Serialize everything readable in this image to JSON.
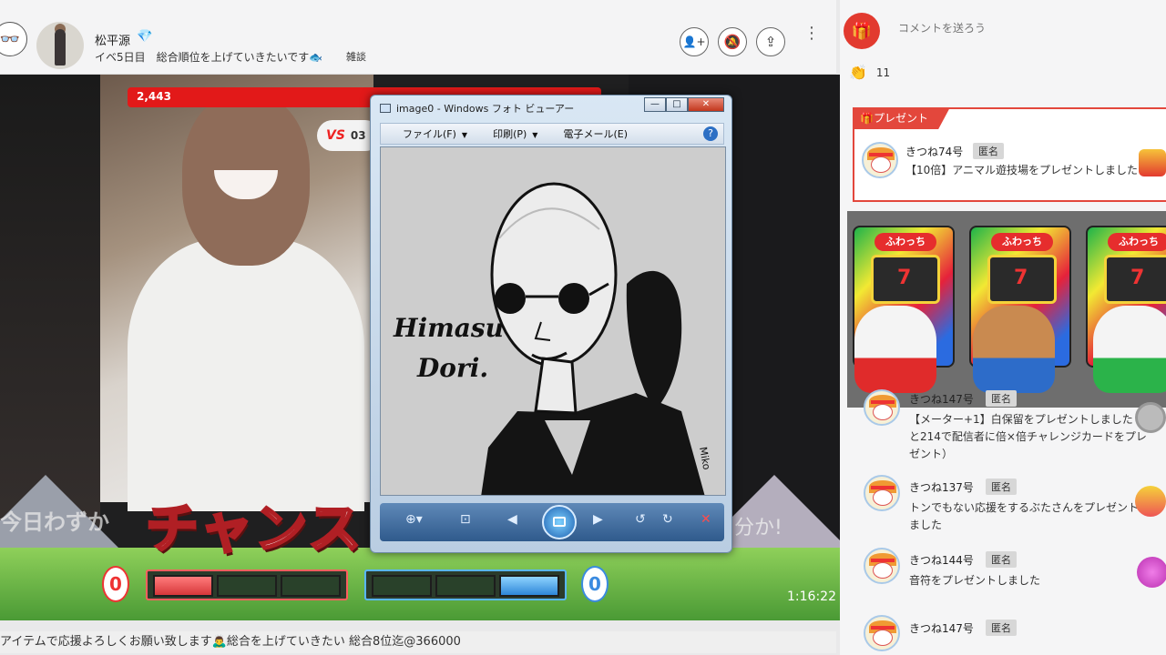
{
  "header": {
    "mini_avatar_glyph": "👓",
    "streamer_name": "松平源",
    "diamond_glyph": "💎",
    "subtitle": "イベ5日目　総合順位を上げていきたいです🐟",
    "tag": "雑談",
    "buttons": {
      "follow_icon": "person-plus-icon",
      "mute_icon": "mute-icon",
      "share_icon": "share-icon",
      "more_icon": "more-vertical-icon",
      "follow_glyph": "👤+",
      "mute_glyph": "🔕",
      "share_glyph": "⇪",
      "more_glyph": "⋮"
    }
  },
  "video": {
    "score": "2,443",
    "vs_label": "VS",
    "vs_value": "03",
    "overlay_text": "チャンス",
    "ticker_left": "今日わずか",
    "ticker_right": "分か!",
    "red_count": "0",
    "blue_count": "0",
    "red_gauge_fill": 0.25,
    "blue_gauge_fill": 0.25,
    "elapsed_time": "1:16:22"
  },
  "viewer_window": {
    "title": "image0 - Windows フォト ビューアー",
    "buttons": {
      "minimize": "—",
      "maximize": "□",
      "close": "✕"
    },
    "menus": [
      {
        "label": "ファイル(F)",
        "caret": "▼"
      },
      {
        "label": "印刷(P)",
        "caret": "▼"
      },
      {
        "label": "電子メール(E)",
        "caret": ""
      }
    ],
    "help_label": "?",
    "drawing": {
      "signature_line1": "Himasu",
      "signature_line2": "Dori.",
      "artist_mark": "Miko"
    },
    "toolbar": {
      "zoom": "⊕▾",
      "fit": "⊡",
      "prev": "◀",
      "next": "▶",
      "rotate_ccw": "↺",
      "rotate_cw": "↻",
      "delete": "✕"
    }
  },
  "panel": {
    "gift_glyph": "🎁",
    "comment_placeholder": "コメントを送ろう",
    "viewers_glyph": "👏",
    "viewer_count": "11",
    "present_label": "🎁プレゼント",
    "events": [
      {
        "user": "きつね74号",
        "anon": "匿名",
        "message": "【10倍】アニマル遊技場をプレゼントしました"
      },
      {
        "user": "きつね147号",
        "anon": "匿名",
        "message": "【メーター+1】白保留をプレゼントしました（あと214で配信者に倍×倍チャレンジカードをプレゼント）"
      },
      {
        "user": "きつね137号",
        "anon": "匿名",
        "message": "トンでもない応援をするぶたさんをプレゼントしました"
      },
      {
        "user": "きつね144号",
        "anon": "匿名",
        "message": "音符をプレゼントしました"
      },
      {
        "user": "きつね147号",
        "anon": "匿名",
        "message": ""
      }
    ],
    "slot_machine_sign": "ふわっち",
    "slot_symbol": "7"
  },
  "footer": {
    "marquee": "アイテムで応援よろしくお願い致します🙇‍♂️総合を上げていきたい 総合8位迄@366000"
  },
  "colors": {
    "accent_red": "#e3473c",
    "score_red": "#e21919",
    "team_blue": "#3a8be0",
    "window_blue": "#2f5a8c"
  }
}
